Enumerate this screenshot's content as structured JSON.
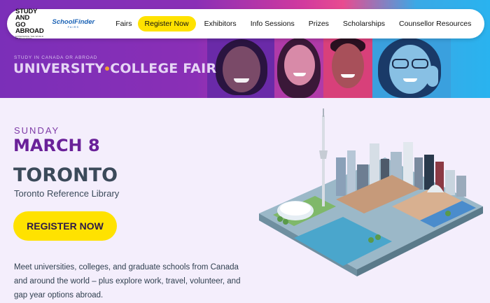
{
  "nav": {
    "logo_study_line1": "STUDY AND",
    "logo_study_line2": "GO ABROAD",
    "logo_study_tagline": "EXPERIENCE THE WORLD OF EDUCATION",
    "logo_schoolfinder": "SchoolFinder",
    "logo_schoolfinder_sub": "FAIRS",
    "links": [
      {
        "label": "Fairs"
      },
      {
        "label": "Register Now"
      },
      {
        "label": "Exhibitors"
      },
      {
        "label": "Info Sessions"
      },
      {
        "label": "Prizes"
      },
      {
        "label": "Scholarships"
      },
      {
        "label": "Counsellor Resources"
      }
    ]
  },
  "banner": {
    "subtitle": "STUDY IN CANADA OR ABROAD",
    "title_part1": "UNIVERSITY",
    "title_part2": "COLLEGE FAIR"
  },
  "event": {
    "day": "SUNDAY",
    "date": "MARCH 8",
    "city": "TORONTO",
    "venue": "Toronto Reference Library",
    "register_label": "REGISTER NOW",
    "description": "Meet universities, colleges, and graduate schools from Canada and around the world – plus explore work, travel, volunteer, and gap year options abroad."
  },
  "colors": {
    "accent_yellow": "#ffe200",
    "purple": "#6a2199",
    "slate": "#3b4a5a"
  }
}
